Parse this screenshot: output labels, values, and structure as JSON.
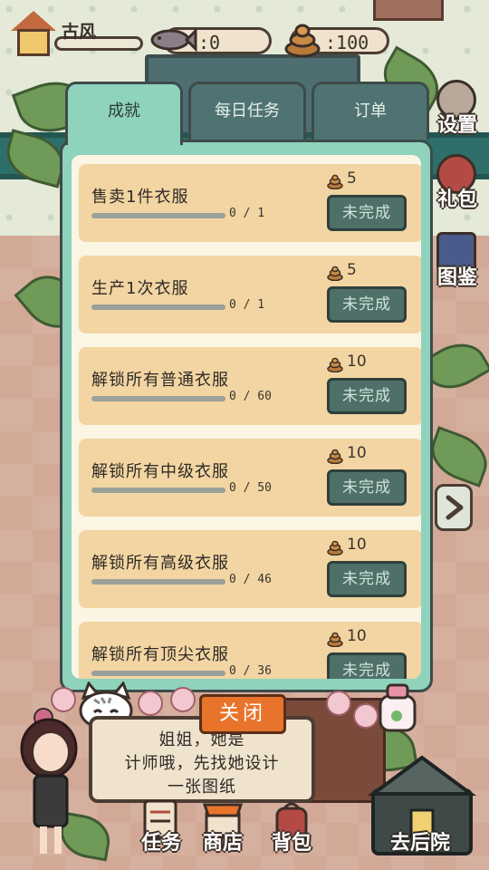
{
  "hud": {
    "player_name": "古风",
    "fish_count": ":0",
    "poop_count": ":100"
  },
  "side_menu": [
    {
      "label": "设置",
      "icon": "gear-icon"
    },
    {
      "label": "礼包",
      "icon": "gift-bag-icon"
    },
    {
      "label": "图鉴",
      "icon": "book-icon"
    }
  ],
  "tabs": [
    {
      "label": "成就",
      "active": true
    },
    {
      "label": "每日任务",
      "active": false
    },
    {
      "label": "订单",
      "active": false
    }
  ],
  "achievements": [
    {
      "title": "售卖1件衣服",
      "progress": "0 / 1",
      "progress_fraction": 0,
      "reward": "5",
      "status": "未完成"
    },
    {
      "title": "生产1次衣服",
      "progress": "0 / 1",
      "progress_fraction": 0,
      "reward": "5",
      "status": "未完成"
    },
    {
      "title": "解锁所有普通衣服",
      "progress": "0 / 60",
      "progress_fraction": 0,
      "reward": "10",
      "status": "未完成"
    },
    {
      "title": "解锁所有中级衣服",
      "progress": "0 / 50",
      "progress_fraction": 0,
      "reward": "10",
      "status": "未完成"
    },
    {
      "title": "解锁所有高级衣服",
      "progress": "0 / 46",
      "progress_fraction": 0,
      "reward": "10",
      "status": "未完成"
    },
    {
      "title": "解锁所有顶尖衣服",
      "progress": "0 / 36",
      "progress_fraction": 0,
      "reward": "10",
      "status": "未完成"
    }
  ],
  "close_label": "关闭",
  "dialog": {
    "line1": "姐姐，她是",
    "line2": "计师哦，先找她设计",
    "line3": "一张图纸"
  },
  "bottom_nav": [
    {
      "label": "任务",
      "icon": "task-icon"
    },
    {
      "label": "商店",
      "icon": "shop-icon"
    },
    {
      "label": "背包",
      "icon": "backpack-icon"
    }
  ],
  "go_backyard_label": "去后院",
  "colors": {
    "panel_mint": "#8fd3bd",
    "tab_inactive": "#4f7373",
    "card": "#f2d5a2",
    "status_button": "#4f7068",
    "close_button": "#e8742c"
  }
}
